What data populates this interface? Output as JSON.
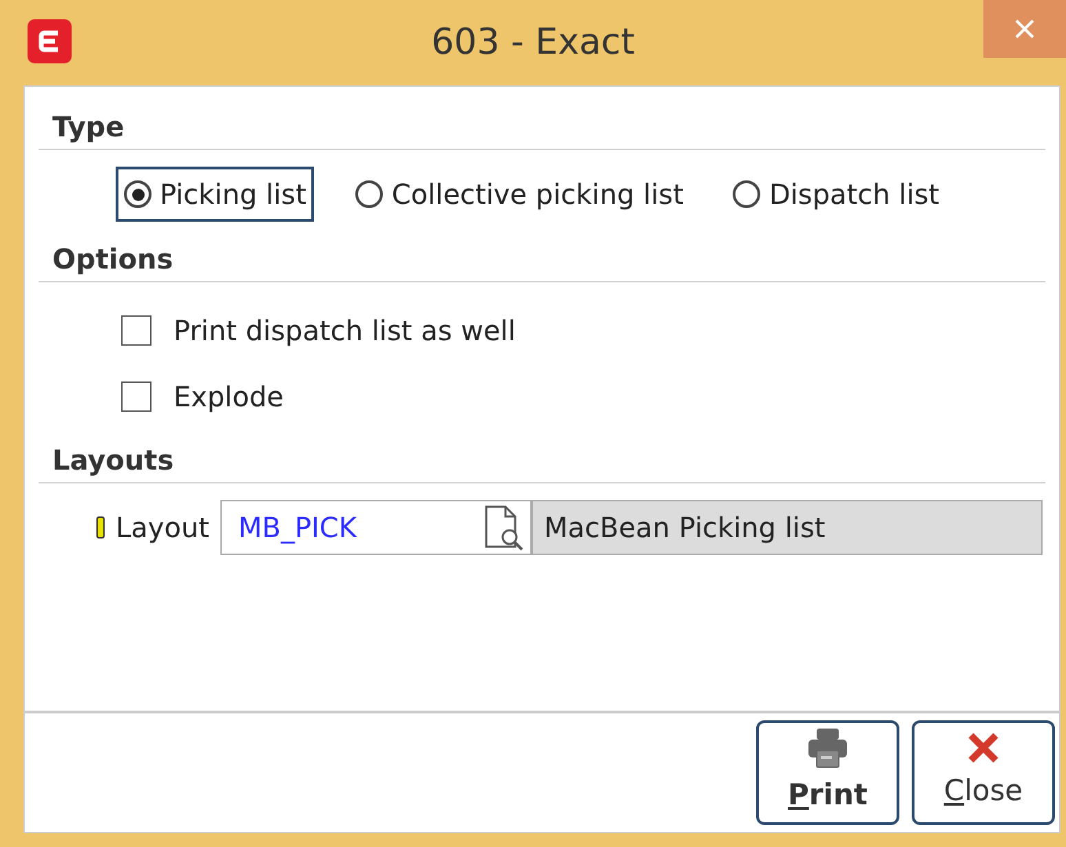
{
  "window": {
    "title": "603  - Exact"
  },
  "sections": [
    {
      "kind": "radios",
      "title": "Type",
      "items": [
        {
          "label": "Picking list",
          "selected": true
        },
        {
          "label": "Collective picking list",
          "selected": false
        },
        {
          "label": "Dispatch list",
          "selected": false
        }
      ]
    },
    {
      "kind": "checkboxes",
      "title": "Options",
      "items": [
        {
          "label": "Print dispatch list as well",
          "checked": false
        },
        {
          "label": "Explode",
          "checked": false
        }
      ]
    },
    {
      "kind": "lookup",
      "title": "Layouts",
      "label": "Layout",
      "required": true,
      "value": "MB_PICK",
      "description": "MacBean Picking list"
    }
  ],
  "buttons": [
    {
      "kind": "print",
      "mnemonic": "P",
      "rest": "rint"
    },
    {
      "kind": "close",
      "mnemonic": "C",
      "rest": "lose"
    }
  ]
}
